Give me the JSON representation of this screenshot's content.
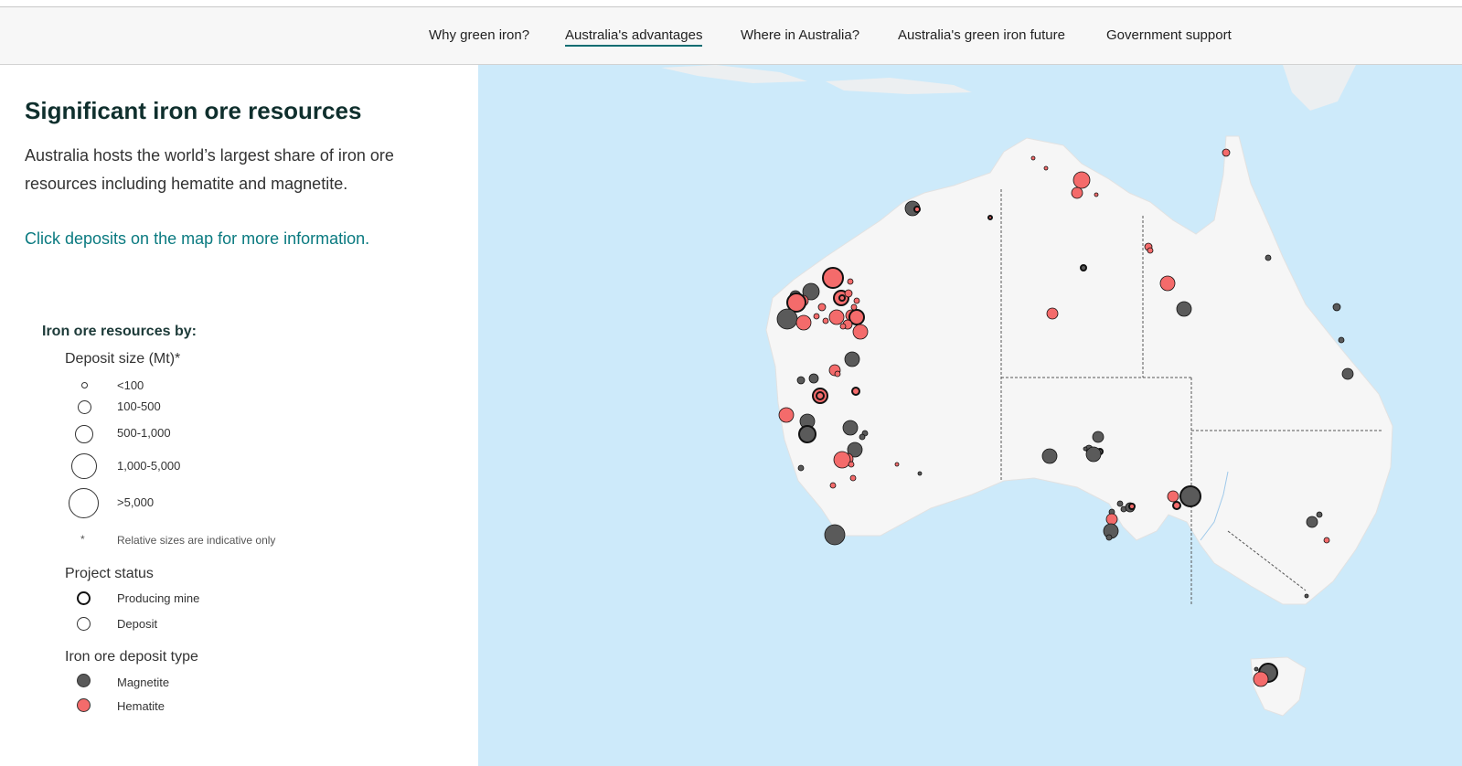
{
  "nav": {
    "items": [
      {
        "label": "Why green iron?",
        "active": false
      },
      {
        "label": "Australia's advantages",
        "active": true
      },
      {
        "label": "Where in Australia?",
        "active": false
      },
      {
        "label": "Australia's green iron future",
        "active": false
      },
      {
        "label": "Government support",
        "active": false
      }
    ]
  },
  "sidebar": {
    "title": "Significant iron ore resources",
    "intro": "Australia hosts the world’s largest share of iron ore resources including hematite and magnetite.",
    "cta": "Click deposits on the map for more information."
  },
  "legend": {
    "heading": "Iron ore resources by:",
    "size_title": "Deposit size (Mt)*",
    "sizes": [
      "<100",
      "100-500",
      "500-1,000",
      "1,000-5,000",
      ">5,000"
    ],
    "note_marker": "*",
    "note": "Relative sizes are indicative only",
    "status_title": "Project status",
    "statuses": [
      "Producing mine",
      "Deposit"
    ],
    "type_title": "Iron ore deposit type",
    "types": [
      "Magnetite",
      "Hematite"
    ]
  },
  "colors": {
    "magnetite": "#5a5a5a",
    "hematite": "#f46b6b",
    "ocean": "#cdeafa",
    "land": "#f6f6f6",
    "accent": "#0a7a80"
  }
}
